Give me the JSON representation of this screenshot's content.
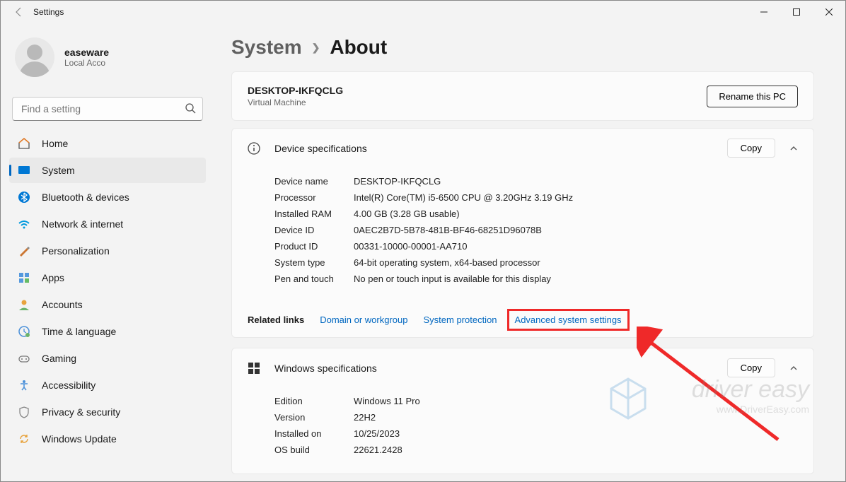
{
  "titlebar": {
    "title": "Settings"
  },
  "profile": {
    "name": "easeware",
    "account_type": "Local Acco"
  },
  "search": {
    "placeholder": "Find a setting"
  },
  "sidebar": {
    "items": [
      {
        "label": "Home",
        "icon": "home-icon"
      },
      {
        "label": "System",
        "icon": "system-icon"
      },
      {
        "label": "Bluetooth & devices",
        "icon": "bluetooth-icon"
      },
      {
        "label": "Network & internet",
        "icon": "wifi-icon"
      },
      {
        "label": "Personalization",
        "icon": "personalization-icon"
      },
      {
        "label": "Apps",
        "icon": "apps-icon"
      },
      {
        "label": "Accounts",
        "icon": "accounts-icon"
      },
      {
        "label": "Time & language",
        "icon": "time-icon"
      },
      {
        "label": "Gaming",
        "icon": "gaming-icon"
      },
      {
        "label": "Accessibility",
        "icon": "accessibility-icon"
      },
      {
        "label": "Privacy & security",
        "icon": "privacy-icon"
      },
      {
        "label": "Windows Update",
        "icon": "update-icon"
      }
    ]
  },
  "breadcrumb": {
    "parent": "System",
    "current": "About"
  },
  "pc": {
    "name": "DESKTOP-IKFQCLG",
    "type": "Virtual Machine",
    "rename_label": "Rename this PC"
  },
  "device_spec": {
    "title": "Device specifications",
    "copy_label": "Copy",
    "rows": [
      {
        "k": "Device name",
        "v": "DESKTOP-IKFQCLG"
      },
      {
        "k": "Processor",
        "v": "Intel(R) Core(TM) i5-6500 CPU @ 3.20GHz   3.19 GHz"
      },
      {
        "k": "Installed RAM",
        "v": "4.00 GB (3.28 GB usable)"
      },
      {
        "k": "Device ID",
        "v": "0AEC2B7D-5B78-481B-BF46-68251D96078B"
      },
      {
        "k": "Product ID",
        "v": "00331-10000-00001-AA710"
      },
      {
        "k": "System type",
        "v": "64-bit operating system, x64-based processor"
      },
      {
        "k": "Pen and touch",
        "v": "No pen or touch input is available for this display"
      }
    ]
  },
  "related": {
    "label": "Related links",
    "links": [
      "Domain or workgroup",
      "System protection",
      "Advanced system settings"
    ]
  },
  "windows_spec": {
    "title": "Windows specifications",
    "copy_label": "Copy",
    "rows": [
      {
        "k": "Edition",
        "v": "Windows 11 Pro"
      },
      {
        "k": "Version",
        "v": "22H2"
      },
      {
        "k": "Installed on",
        "v": "10/25/2023"
      },
      {
        "k": "OS build",
        "v": "22621.2428"
      }
    ]
  },
  "watermark": {
    "line1": "driver easy",
    "line2": "www.DriverEasy.com"
  }
}
